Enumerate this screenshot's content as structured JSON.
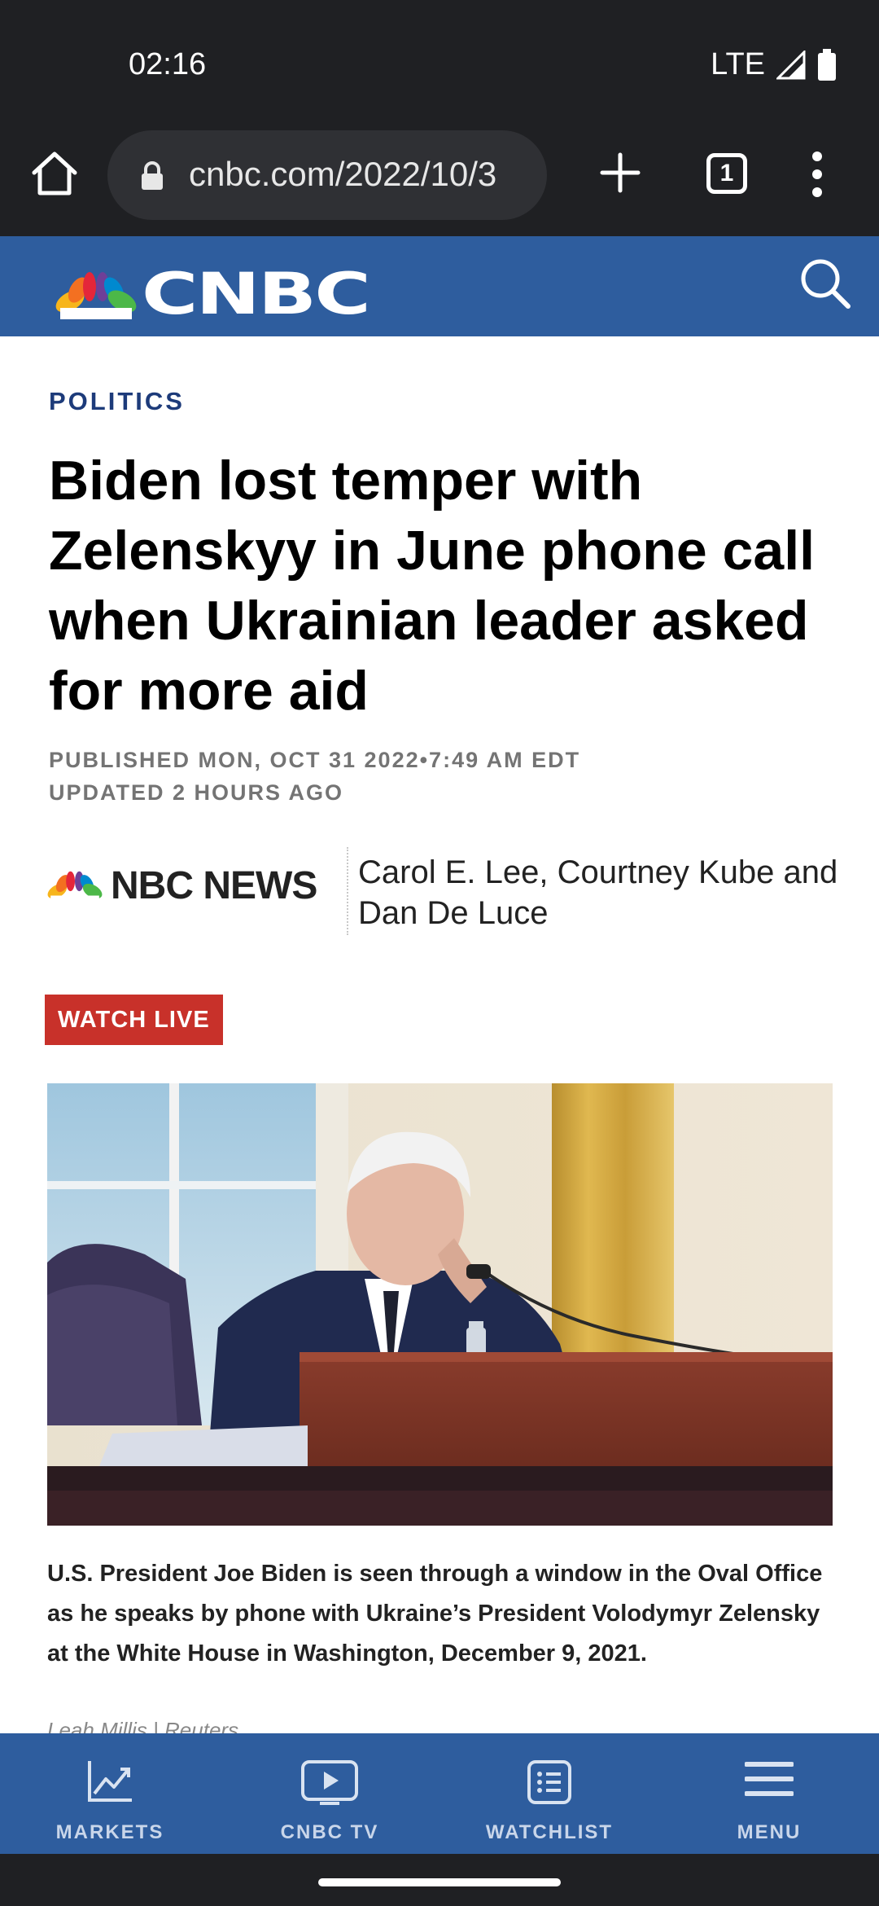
{
  "status_bar": {
    "time": "02:16",
    "network": "LTE"
  },
  "browser": {
    "url": "cnbc.com/2022/10/3",
    "tab_count": "1"
  },
  "header": {
    "brand": "CNBC"
  },
  "article": {
    "kicker": "POLITICS",
    "headline": "Biden lost temper with Zelenskyy in June phone call when Ukrainian leader asked for more aid",
    "published": "PUBLISHED MON, OCT 31 2022•7:49 AM EDT",
    "updated": "UPDATED 2 HOURS AGO",
    "source": "NBC NEWS",
    "authors": "Carol E. Lee, Courtney Kube and Dan De Luce",
    "watch_live": "WATCH LIVE",
    "caption": "U.S. President Joe Biden is seen through a window in the Oval Office as he speaks by phone with Ukraine’s President Volodymyr Zelensky at the White House in Washington, December 9, 2021.",
    "credit": "Leah Millis | Reuters"
  },
  "bottom_nav": [
    {
      "label": "MARKETS",
      "icon": "chart-icon"
    },
    {
      "label": "CNBC TV",
      "icon": "play-icon"
    },
    {
      "label": "WATCHLIST",
      "icon": "list-icon"
    },
    {
      "label": "MENU",
      "icon": "menu-icon"
    }
  ],
  "colors": {
    "cnbc_blue": "#2e5d9e",
    "kicker_blue": "#1d3b7a",
    "watch_live_red": "#c8312a",
    "chrome_dark": "#1f2023"
  }
}
